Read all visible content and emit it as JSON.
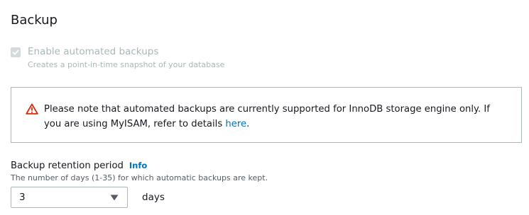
{
  "section": {
    "title": "Backup"
  },
  "automated_backups": {
    "checked": true,
    "disabled": true,
    "label": "Enable automated backups",
    "description": "Creates a point-in-time snapshot of your database"
  },
  "alert": {
    "icon": "warning-icon",
    "icon_color": "#d13212",
    "text_before_link": "Please note that automated backups are currently supported for InnoDB storage engine only. If you are using MyISAM, refer to details ",
    "link_text": "here",
    "text_after_link": "."
  },
  "retention": {
    "label": "Backup retention period",
    "info_link": "Info",
    "description": "The number of days (1-35) for which automatic backups are kept.",
    "selected_value": "3",
    "unit": "days"
  },
  "colors": {
    "link": "#0073bb",
    "text": "#16191f",
    "disabled_text": "#aab7b8",
    "border": "#aab7b8"
  }
}
